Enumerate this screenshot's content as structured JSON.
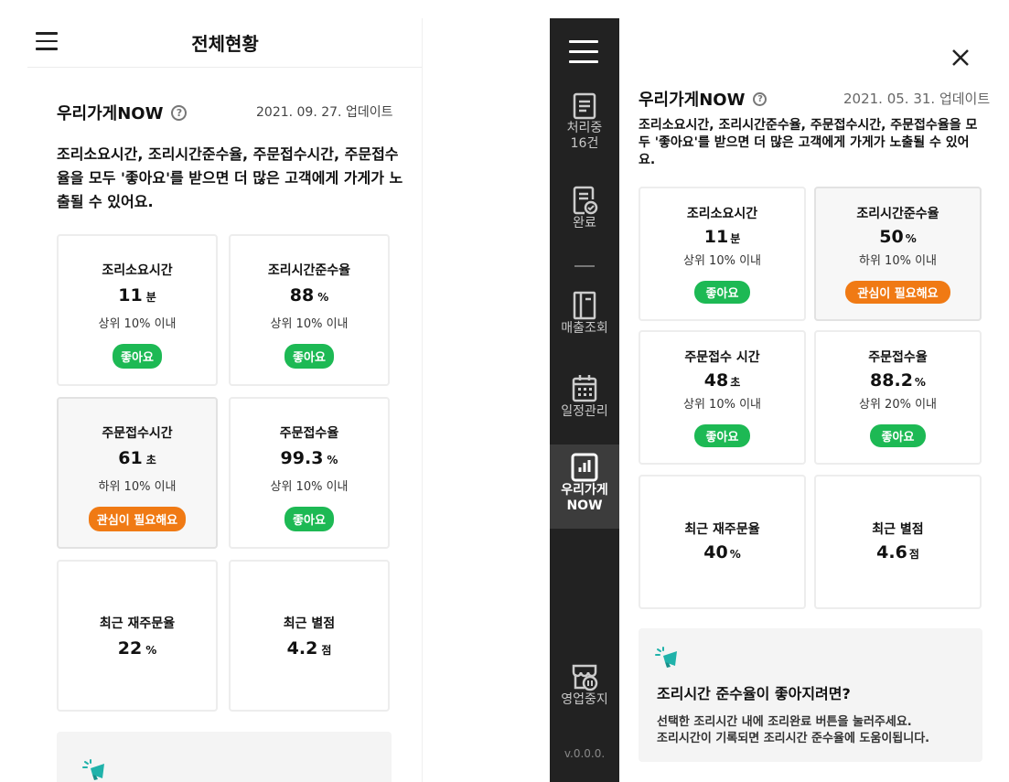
{
  "left": {
    "header_title": "전체현황",
    "section_title": "우리가게NOW",
    "help": "?",
    "update_date": "2021. 09. 27. 업데이트",
    "description": "조리소요시간, 조리시간준수율, 주문접수시간, 주문접수율을 모두 '좋아요'를 받으면 더 많은 고객에게 가게가 노출될 수 있어요.",
    "metrics": [
      {
        "label": "조리소요시간",
        "value": "11",
        "unit": "분",
        "rank": "상위 10% 이내",
        "badge": "좋아요",
        "status": "good"
      },
      {
        "label": "조리시간준수율",
        "value": "88",
        "unit": "%",
        "rank": "상위 10% 이내",
        "badge": "좋아요",
        "status": "good"
      },
      {
        "label": "주문접수시간",
        "value": "61",
        "unit": "초",
        "rank": "하위 10% 이내",
        "badge": "관심이 필요해요",
        "status": "bad"
      },
      {
        "label": "주문접수율",
        "value": "99.3",
        "unit": "%",
        "rank": "상위 10% 이내",
        "badge": "좋아요",
        "status": "good"
      },
      {
        "label": "최근 재주문율",
        "value": "22",
        "unit": "%"
      },
      {
        "label": "최근 별점",
        "value": "4.2",
        "unit": "점"
      }
    ]
  },
  "right": {
    "section_title": "우리가게NOW",
    "help": "?",
    "update_date": "2021. 05. 31. 업데이트",
    "description": "조리소요시간, 조리시간준수율, 주문접수시간, 주문접수율을 모두 '좋아요'를 받으면 더 많은 고객에게 가게가 노출될 수 있어요.",
    "sidebar": {
      "items": [
        {
          "label": "처리중",
          "count": "16건",
          "icon": "document-icon"
        },
        {
          "label": "완료",
          "icon": "document-check-icon"
        },
        {
          "label": "매출조회",
          "icon": "sales-book-icon"
        },
        {
          "label": "일정관리",
          "icon": "calendar-icon"
        },
        {
          "label": "우리가게",
          "label2": "NOW",
          "icon": "bar-chart-icon",
          "active": true
        },
        {
          "label": "영업중지",
          "icon": "store-pause-icon"
        }
      ],
      "version": "v.0.0.0."
    },
    "metrics": [
      {
        "label": "조리소요시간",
        "value": "11",
        "unit": "분",
        "rank": "상위 10% 이내",
        "badge": "좋아요",
        "status": "good"
      },
      {
        "label": "조리시간준수율",
        "value": "50",
        "unit": "%",
        "rank": "하위 10% 이내",
        "badge": "관심이 필요해요",
        "status": "bad"
      },
      {
        "label": "주문접수 시간",
        "value": "48",
        "unit": "초",
        "rank": "상위 10% 이내",
        "badge": "좋아요",
        "status": "good"
      },
      {
        "label": "주문접수율",
        "value": "88.2",
        "unit": "%",
        "rank": "상위 20% 이내",
        "badge": "좋아요",
        "status": "good"
      },
      {
        "label": "최근 재주문율",
        "value": "40",
        "unit": "%"
      },
      {
        "label": "최근 별점",
        "value": "4.6",
        "unit": "점"
      }
    ],
    "tip": {
      "title": "조리시간 준수율이 좋아지려면?",
      "body_line1": "선택한 조리시간 내에 조리완료 버튼을 눌러주세요.",
      "body_line2": "조리시간이 기록되면 조리시간 준수율에 도움이됩니다."
    }
  },
  "colors": {
    "good": "#1db954",
    "bad": "#f07a14",
    "sidebar_bg": "#222222",
    "megaphone": "#20b2aa"
  }
}
